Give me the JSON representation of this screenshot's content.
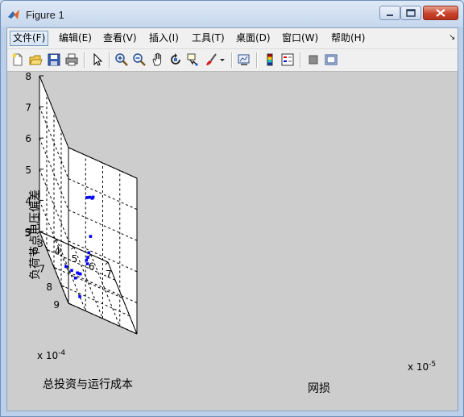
{
  "window": {
    "title": "Figure 1"
  },
  "menu": {
    "items": [
      "文件(F)",
      "编辑(E)",
      "查看(V)",
      "插入(I)",
      "工具(T)",
      "桌面(D)",
      "窗口(W)",
      "帮助(H)"
    ]
  },
  "toolbar": {
    "icons": [
      "new-figure-icon",
      "open-file-icon",
      "save-icon",
      "print-icon",
      "pointer-icon",
      "zoom-in-icon",
      "zoom-out-icon",
      "pan-hand-icon",
      "rotate-3d-icon",
      "data-cursor-icon",
      "brush-icon",
      "dropdown-arrow-icon",
      "link-plot-icon",
      "colorbar-icon",
      "legend-icon",
      "hide-plot-tools-icon",
      "show-plot-tools-icon"
    ]
  },
  "colors": {
    "marker": "#0000ff",
    "background": "#cdcdcd"
  },
  "chart_data": {
    "type": "scatter",
    "view": "3d",
    "xlabel": "网损",
    "ylabel": "总投资与运行成本",
    "zlabel": "负荷节点电压偏差",
    "x_multiplier": "x 10^-5",
    "y_multiplier": "x 10^-4",
    "x_ticks": [
      "3",
      "4",
      "5",
      "6",
      "7"
    ],
    "y_ticks": [
      "5",
      "6",
      "7",
      "8",
      "9"
    ],
    "z_ticks": [
      "3",
      "4",
      "5",
      "6",
      "7",
      "8"
    ],
    "xlim": [
      3,
      7
    ],
    "ylim": [
      5,
      9
    ],
    "zlim": [
      3,
      8
    ],
    "grid": true,
    "grid_style": "dashed",
    "points": [
      {
        "x": 4.0,
        "y": 8.2,
        "z": 3.0
      },
      {
        "x": 3.7,
        "y": 7.0,
        "z": 3.2
      },
      {
        "x": 3.95,
        "y": 7.2,
        "z": 3.25
      },
      {
        "x": 4.0,
        "y": 7.6,
        "z": 3.25
      },
      {
        "x": 4.2,
        "y": 7.4,
        "z": 3.35
      },
      {
        "x": 4.3,
        "y": 7.4,
        "z": 3.35
      },
      {
        "x": 4.35,
        "y": 7.45,
        "z": 3.38
      },
      {
        "x": 4.9,
        "y": 7.0,
        "z": 3.7
      },
      {
        "x": 4.85,
        "y": 7.3,
        "z": 3.95
      },
      {
        "x": 5.0,
        "y": 6.9,
        "z": 3.55
      },
      {
        "x": 5.1,
        "y": 6.85,
        "z": 3.9
      },
      {
        "x": 5.2,
        "y": 6.85,
        "z": 4.45
      },
      {
        "x": 5.4,
        "y": 5.9,
        "z": 5.2
      },
      {
        "x": 5.6,
        "y": 5.8,
        "z": 5.2
      },
      {
        "x": 5.7,
        "y": 5.9,
        "z": 5.25
      },
      {
        "x": 5.75,
        "y": 5.9,
        "z": 5.3
      }
    ]
  }
}
